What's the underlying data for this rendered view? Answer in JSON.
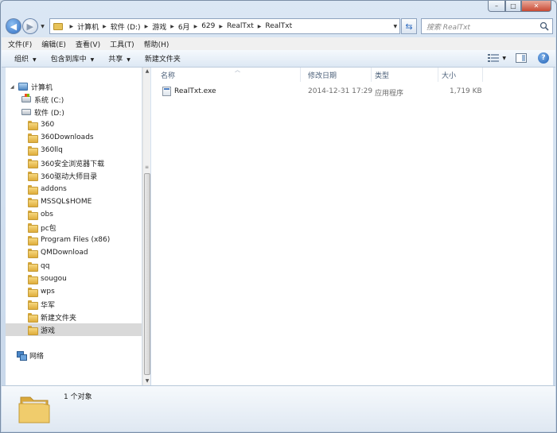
{
  "window": {
    "controls": {
      "minimize": "–",
      "maximize": "□",
      "close": "✕"
    }
  },
  "address": {
    "crumbs": [
      "计算机",
      "软件 (D:)",
      "游戏",
      "6月",
      "629",
      "RealTxt",
      "RealTxt"
    ],
    "search_placeholder": "搜索 RealTxt"
  },
  "menu": [
    "文件(F)",
    "编辑(E)",
    "查看(V)",
    "工具(T)",
    "帮助(H)"
  ],
  "toolbar": {
    "organize": "组织",
    "include_in_library": "包含到库中",
    "share": "共享",
    "new_folder": "新建文件夹"
  },
  "nav": {
    "computer": "计算机",
    "system_drive": "系统 (C:)",
    "software_drive": "软件 (D:)",
    "folders": [
      "360",
      "360Downloads",
      "360llq",
      "360安全浏览器下载",
      "360驱动大师目录",
      "addons",
      "MSSQL$HOME",
      "obs",
      "pc包",
      "Program Files (x86)",
      "QMDownload",
      "qq",
      "sougou",
      "wps",
      "华军",
      "新建文件夹",
      "游戏"
    ],
    "selected_folder": "游戏",
    "network": "网络"
  },
  "columns": {
    "name": "名称",
    "modified": "修改日期",
    "type": "类型",
    "size": "大小"
  },
  "files": [
    {
      "name": "RealTxt.exe",
      "modified": "2014-12-31 17:29",
      "type": "应用程序",
      "size": "1,719 KB"
    }
  ],
  "details": {
    "count": "1 个对象"
  },
  "colors": {
    "window_frame": "#cfdbe8",
    "selection": "#d9d9d9",
    "folder": "#e9c25a"
  },
  "icons": [
    "back-arrow-icon",
    "forward-arrow-icon",
    "refresh-icon",
    "search-icon",
    "view-options-icon",
    "preview-pane-icon",
    "help-icon",
    "folder-icon",
    "computer-icon",
    "drive-icon",
    "network-icon",
    "exe-icon"
  ]
}
